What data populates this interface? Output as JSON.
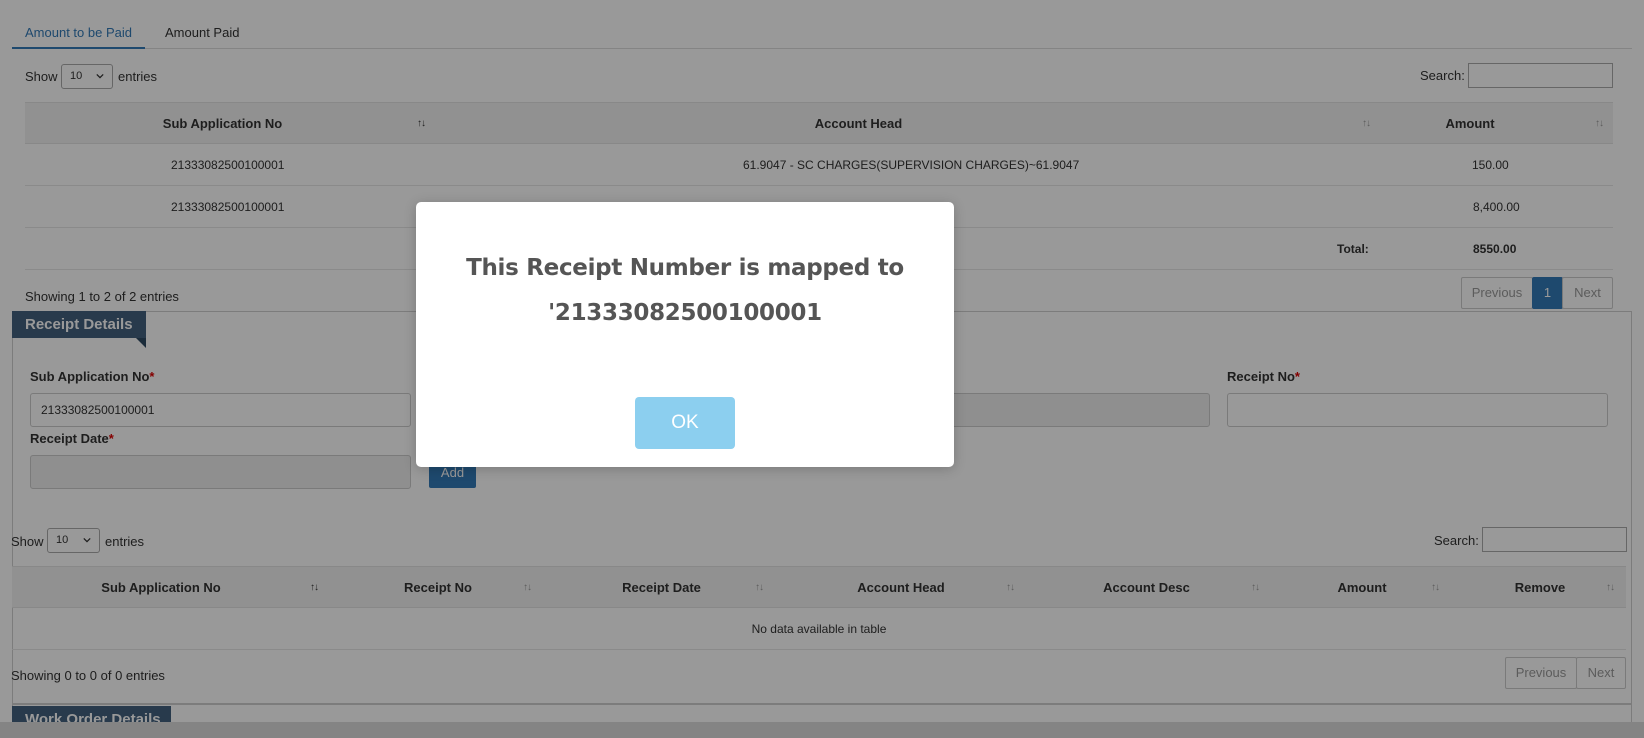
{
  "tabs": [
    {
      "label": "Amount to be Paid"
    },
    {
      "label": "Amount Paid"
    }
  ],
  "top_table": {
    "show_label": "Show",
    "entries_value": "10",
    "entries_label": "entries",
    "search_label": "Search:",
    "columns": [
      "Sub Application No",
      "Account Head",
      "Amount"
    ],
    "rows": [
      {
        "sub_app": "21333082500100001",
        "account_head": "61.9047 - SC CHARGES(SUPERVISION CHARGES)~61.9047",
        "amount": "150.00"
      },
      {
        "sub_app": "21333082500100001",
        "account_head": "",
        "amount": "8,400.00"
      }
    ],
    "total_label": "Total:",
    "total_value": "8550.00",
    "info": "Showing 1 to 2 of 2 entries",
    "pager": {
      "previous": "Previous",
      "current": "1",
      "next": "Next"
    }
  },
  "receipt_details": {
    "title": "Receipt Details",
    "sub_app_label": "Sub Application No",
    "sub_app_value": "21333082500100001",
    "receipt_no_label": "Receipt No",
    "receipt_date_label": "Receipt Date",
    "required_mark": "*",
    "add_label": "Add"
  },
  "bottom_table": {
    "show_label": "Show",
    "entries_value": "10",
    "entries_label": "entries",
    "search_label": "Search:",
    "columns": [
      "Sub Application No",
      "Receipt No",
      "Receipt Date",
      "Account Head",
      "Account Desc",
      "Amount",
      "Remove"
    ],
    "empty_text": "No data available in table",
    "info": "Showing 0 to 0 of 0 entries",
    "pager": {
      "previous": "Previous",
      "next": "Next"
    }
  },
  "work_order": {
    "title": "Work Order Details"
  },
  "modal": {
    "line1": "This Receipt Number is mapped to",
    "line2": "'21333082500100001",
    "ok_label": "OK",
    "ok_color": "#8ccfef"
  },
  "colors": {
    "accent": "#337ab7",
    "ribbon": "#44627f"
  }
}
